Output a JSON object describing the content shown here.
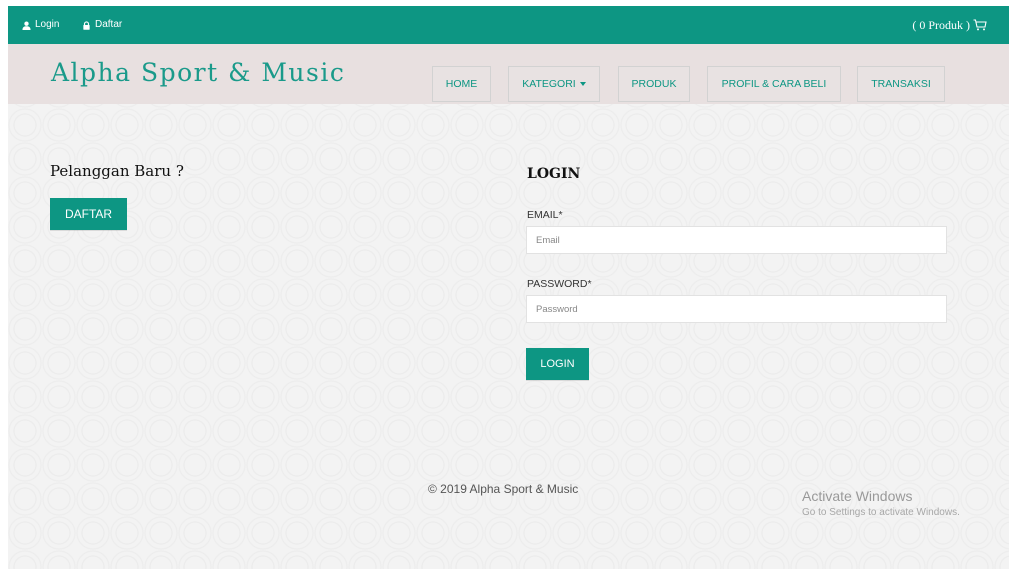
{
  "topbar": {
    "login_label": "Login",
    "register_label": "Daftar",
    "cart_label": "( 0 Produk )",
    "color": "#0d9683"
  },
  "header": {
    "brand": "Alpha Sport & Music",
    "nav": {
      "home": "HOME",
      "kategori": "KATEGORI",
      "produk": "PRODUK",
      "profil": "PROFIL & CARA BELI",
      "transaksi": "TRANSAKSI"
    }
  },
  "new_customer": {
    "title": "Pelanggan Baru ?",
    "register_button": "DAFTAR"
  },
  "login": {
    "title": "LOGIN",
    "email_label": "EMAIL*",
    "email_placeholder": "Email",
    "password_label": "PASSWORD*",
    "password_placeholder": "Password",
    "submit_button": "LOGIN"
  },
  "footer": {
    "copyright": "© 2019 Alpha Sport & Music"
  },
  "watermark": {
    "title": "Activate Windows",
    "subtitle": "Go to Settings to activate Windows."
  }
}
